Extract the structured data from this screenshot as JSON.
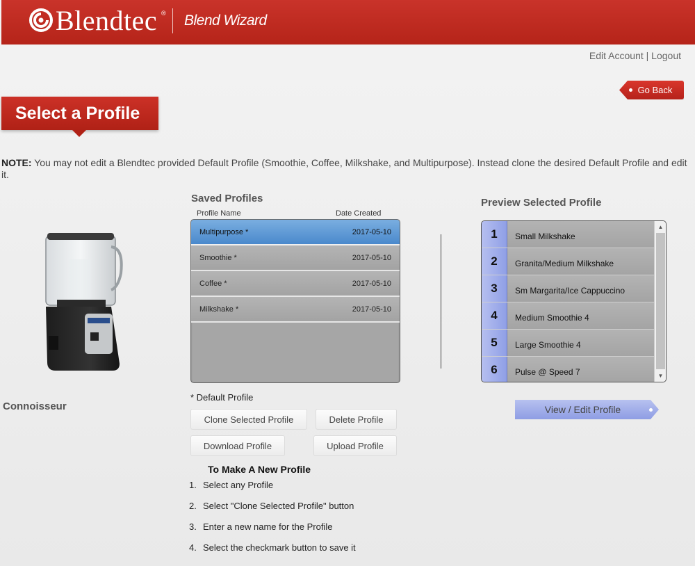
{
  "header": {
    "brand": "Blendtec",
    "app_name": "Blend Wizard"
  },
  "top_links": {
    "edit_account": "Edit Account",
    "separator": "|",
    "logout": "Logout"
  },
  "go_back": "Go Back",
  "page_title": "Select a Profile",
  "note": {
    "label": "NOTE:",
    "text": " You may not edit a Blendtec provided Default Profile (Smoothie, Coffee, Milkshake, and Multipurpose). Instead clone the desired Default Profile and edit it."
  },
  "blender": {
    "model": "Connoisseur"
  },
  "saved_profiles": {
    "title": "Saved Profiles",
    "col_name": "Profile Name",
    "col_date": "Date Created",
    "rows": [
      {
        "name": "Multipurpose *",
        "date": "2017-05-10",
        "selected": true
      },
      {
        "name": "Smoothie *",
        "date": "2017-05-10",
        "selected": false
      },
      {
        "name": "Coffee *",
        "date": "2017-05-10",
        "selected": false
      },
      {
        "name": "Milkshake *",
        "date": "2017-05-10",
        "selected": false
      }
    ],
    "default_note": "* Default Profile"
  },
  "buttons": {
    "clone": "Clone Selected Profile",
    "delete": "Delete Profile",
    "download": "Download Profile",
    "upload": "Upload Profile"
  },
  "howto": {
    "title": "To Make A New Profile",
    "steps": [
      {
        "num": "1.",
        "text": "Select any Profile"
      },
      {
        "num": "2.",
        "text": "Select \"Clone Selected Profile\" button"
      },
      {
        "num": "3.",
        "text": "Enter a new name for the Profile"
      },
      {
        "num": "4.",
        "text": "Select the checkmark button to save it"
      }
    ]
  },
  "preview": {
    "title": "Preview Selected Profile",
    "items": [
      {
        "num": "1",
        "name": "Small Milkshake"
      },
      {
        "num": "2",
        "name": "Granita/Medium Milkshake"
      },
      {
        "num": "3",
        "name": "Sm Margarita/Ice Cappuccino"
      },
      {
        "num": "4",
        "name": "Medium Smoothie 4"
      },
      {
        "num": "5",
        "name": "Large Smoothie 4"
      },
      {
        "num": "6",
        "name": "Pulse @ Speed 7"
      }
    ],
    "view_edit": "View / Edit Profile"
  }
}
